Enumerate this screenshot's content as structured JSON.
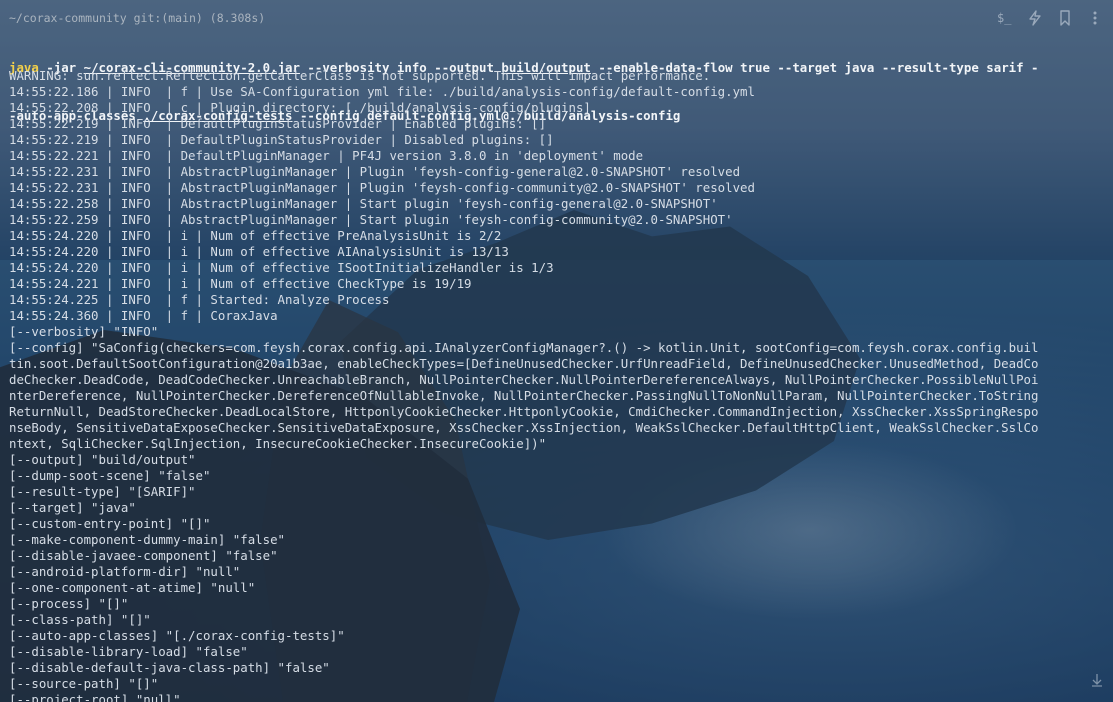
{
  "window": {
    "prompt_dir": "~/corax-community git:(main) (8.308s)"
  },
  "command": {
    "keyword": "java",
    "segments": [
      {
        "text": " -jar ",
        "underline": false
      },
      {
        "text": "~/corax-cli-community-2.0.jar",
        "underline": true
      },
      {
        "text": " --verbosity info --output ",
        "underline": false
      },
      {
        "text": "build/output",
        "underline": true
      },
      {
        "text": " --enable-data-flow true --target java --result-type sarif -",
        "underline": false
      }
    ],
    "line2_segments": [
      {
        "text": "-auto-app-classes ",
        "underline": false
      },
      {
        "text": "./corax-config-tests",
        "underline": true
      },
      {
        "text": " --config default-config.yml@./build/analysis-config",
        "underline": false
      }
    ]
  },
  "output_lines": [
    "WARNING: sun.reflect.Reflection.getCallerClass is not supported. This will impact performance.",
    "14:55:22.186 | INFO  | f | Use SA-Configuration yml file: ./build/analysis-config/default-config.yml",
    "14:55:22.208 | INFO  | c | Plugin directory: [./build/analysis-config/plugins]",
    "14:55:22.219 | INFO  | DefaultPluginStatusProvider | Enabled plugins: []",
    "14:55:22.219 | INFO  | DefaultPluginStatusProvider | Disabled plugins: []",
    "14:55:22.221 | INFO  | DefaultPluginManager | PF4J version 3.8.0 in 'deployment' mode",
    "14:55:22.231 | INFO  | AbstractPluginManager | Plugin 'feysh-config-general@2.0-SNAPSHOT' resolved",
    "14:55:22.231 | INFO  | AbstractPluginManager | Plugin 'feysh-config-community@2.0-SNAPSHOT' resolved",
    "14:55:22.258 | INFO  | AbstractPluginManager | Start plugin 'feysh-config-general@2.0-SNAPSHOT'",
    "14:55:22.259 | INFO  | AbstractPluginManager | Start plugin 'feysh-config-community@2.0-SNAPSHOT'",
    "14:55:24.220 | INFO  | i | Num of effective PreAnalysisUnit is 2/2",
    "14:55:24.220 | INFO  | i | Num of effective AIAnalysisUnit is 13/13",
    "14:55:24.220 | INFO  | i | Num of effective ISootInitializeHandler is 1/3",
    "14:55:24.221 | INFO  | i | Num of effective CheckType is 19/19",
    "14:55:24.225 | INFO  | f | Started: Analyze Process",
    "14:55:24.360 | INFO  | f | CoraxJava",
    "[--verbosity] \"INFO\"",
    "[--config] \"SaConfig(checkers=com.feysh.corax.config.api.IAnalyzerConfigManager?.() -> kotlin.Unit, sootConfig=com.feysh.corax.config.buil",
    "tin.soot.DefaultSootConfiguration@20a1b3ae, enableCheckTypes=[DefineUnusedChecker.UrfUnreadField, DefineUnusedChecker.UnusedMethod, DeadCo",
    "deChecker.DeadCode, DeadCodeChecker.UnreachableBranch, NullPointerChecker.NullPointerDereferenceAlways, NullPointerChecker.PossibleNullPoi",
    "nterDereference, NullPointerChecker.DereferenceOfNullableInvoke, NullPointerChecker.PassingNullToNonNullParam, NullPointerChecker.ToString",
    "ReturnNull, DeadStoreChecker.DeadLocalStore, HttponlyCookieChecker.HttponlyCookie, CmdiChecker.CommandInjection, XssChecker.XssSpringRespo",
    "nseBody, SensitiveDataExposeChecker.SensitiveDataExposure, XssChecker.XssInjection, WeakSslChecker.DefaultHttpClient, WeakSslChecker.SslCo",
    "ntext, SqliChecker.SqlInjection, InsecureCookieChecker.InsecureCookie])\"",
    "[--output] \"build/output\"",
    "[--dump-soot-scene] \"false\"",
    "[--result-type] \"[SARIF]\"",
    "[--target] \"java\"",
    "[--custom-entry-point] \"[]\"",
    "[--make-component-dummy-main] \"false\"",
    "[--disable-javaee-component] \"false\"",
    "[--android-platform-dir] \"null\"",
    "[--one-component-at-atime] \"null\"",
    "[--process] \"[]\"",
    "[--class-path] \"[]\"",
    "[--auto-app-classes] \"[./corax-config-tests]\"",
    "[--disable-library-load] \"false\"",
    "[--disable-default-java-class-path] \"false\"",
    "[--source-path] \"[]\"",
    "[--project-root] \"null\""
  ],
  "toolbar": {
    "icons": [
      "terminal-prompt-icon",
      "lightning-icon",
      "bookmark-icon",
      "more-vertical-icon"
    ]
  },
  "colors": {
    "keyword": "#f2d04a",
    "text": "#d6dde6",
    "command": "#f2f5f8"
  }
}
